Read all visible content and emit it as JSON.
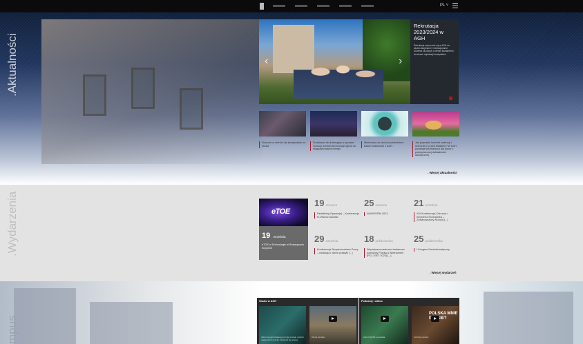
{
  "header": {
    "lang": "PL ˅",
    "menu_icon": "hamburger-icon"
  },
  "sections": {
    "news_title": ".Aktualności",
    "events_title": ".Wydarzenia",
    "campus_title": "mpus"
  },
  "slider": {
    "title": "Rekrutacja 2023/2024 w AGH",
    "text": "Rekrutacja rozpocznie się w AGH na studia stacjonarne i niestacjonarne. Dowiedz się więcej o ofercie kształcenia i terminach rejestracji kandydatów.",
    "prev_icon": "chevron-left-icon",
    "next_icon": "chevron-right-icon"
  },
  "news": [
    {
      "text": "Nowości w ofercie dla kandydatów na studia"
    },
    {
      "text": "Podpisano list intencyjny w sprawie rozwoju polskiej technologii ogniw do magazynowania energii"
    },
    {
      "text": "Membrana ze skrobi przedmiotem badań doktoranki z AGH"
    },
    {
      "text": "Jak poprawić komfort zwierząt i ochronić je przed hałasem? W AGH powstaje pochłaniacz dla psów o podwyższonej dokładności akustycznej"
    }
  ],
  "news_more": ". Więcej aktualności",
  "featured_event": {
    "image_label": "eTOE",
    "day": "19",
    "month": "września",
    "desc": "eTOE w Technologie w Rozwiązaniu Inżynierii"
  },
  "events": [
    {
      "day": "19",
      "month": "czerwca",
      "desc": "Redefining Spaces(s) – Konferencja re-Wsmorodowski"
    },
    {
      "day": "25",
      "month": "czerwca",
      "desc": "NUMIFORM 2023"
    },
    {
      "day": "21",
      "month": "września",
      "desc": "XIV Konferencja Ochrona i Inżynieria Środowiska – Zrównoważony Rozwój [...]"
    },
    {
      "day": "29",
      "month": "września",
      "desc": "Konferencja Bezpieczeństwo Pracy – edukacja i dobre praktyki [...]"
    },
    {
      "day": "18",
      "month": "października",
      "desc": "Współpraca naukowo-badawcza pomiędzy Polską a Wietnamem (PCL-VIET 2023) [...]"
    },
    {
      "day": "25",
      "month": "października",
      "desc": "I Kongres Geoinformatyczny"
    }
  ],
  "events_more": ". Więcej wydarzeń",
  "media": {
    "studio_label": "Studio w AGH",
    "podcast_label": "Podcasty i wideo",
    "polska_text": "POLSKA MNIE PARSIE?",
    "videos": [
      {
        "caption": "AGH ma ugruntowaną pozycję w kraju i wśród najlepszych uczelni. Dowiedz się więcej"
      },
      {
        "caption": "Oferta studiów"
      },
      {
        "caption": "AGH HAUSK opowiada"
      },
      {
        "caption": "Technik mediów"
      }
    ]
  },
  "colors": {
    "accent": "#a71930",
    "dark": "#24282f",
    "events_bg": "#e3e3e3"
  }
}
